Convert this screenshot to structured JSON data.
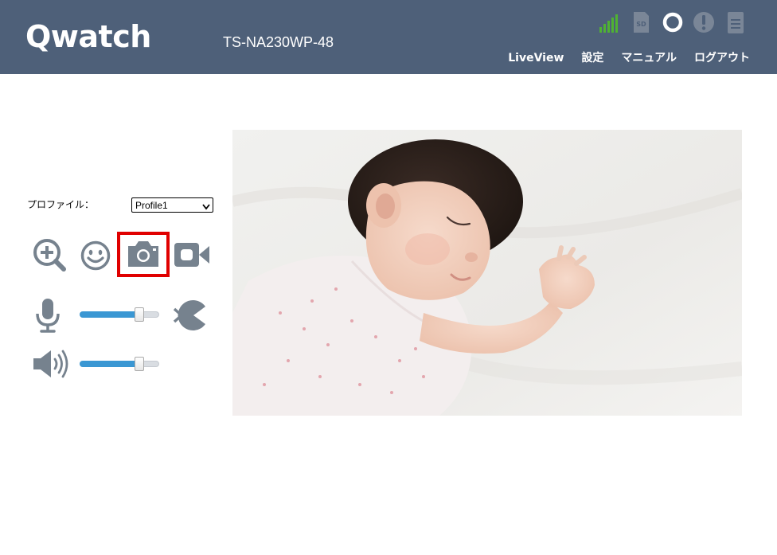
{
  "header": {
    "logo": "Qwatch",
    "device_name": "TS-NA230WP-48",
    "status_icons": [
      "wifi-signal-icon",
      "sd-card-icon",
      "record-status-icon",
      "alert-icon",
      "battery-icon"
    ],
    "nav": {
      "liveview": "LiveView",
      "settings": "設定",
      "manual": "マニュアル",
      "logout": "ログアウト"
    }
  },
  "controls": {
    "profile_label": "プロファイル：",
    "profile_value": "Profile1",
    "mic_volume": 0.78,
    "speaker_volume": 0.78,
    "icons": [
      "zoom-in-icon",
      "face-detection-icon",
      "snapshot-camera-icon",
      "video-record-icon",
      "microphone-icon",
      "talk-icon",
      "speaker-icon"
    ]
  },
  "colors": {
    "header_bg": "#4e6079",
    "icon_gray": "#76828e",
    "slider_fill": "#3a97d3",
    "highlight": "#e00000",
    "wifi_green": "#4fb233"
  },
  "video": {
    "description_icon": "live-video-feed"
  }
}
